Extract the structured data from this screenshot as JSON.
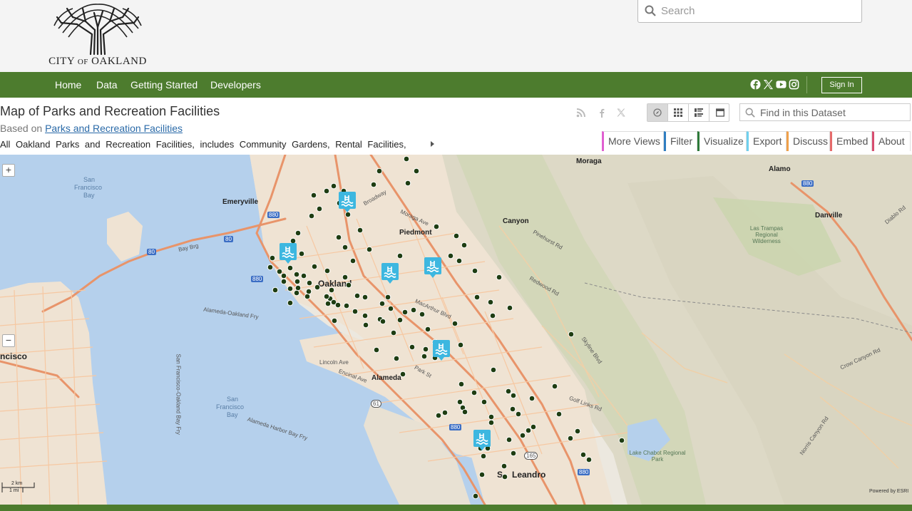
{
  "logo": {
    "text_city": "CITY",
    "text_of": "OF",
    "text_oakland": "OAKLAND"
  },
  "site_search": {
    "placeholder": "Search"
  },
  "nav": {
    "items": [
      "Home",
      "Data",
      "Getting Started",
      "Developers"
    ],
    "social_icons": [
      "facebook-icon",
      "x-twitter-icon",
      "youtube-icon",
      "instagram-icon"
    ],
    "sign_in": "Sign In"
  },
  "dataset": {
    "title": "Map of Parks and Recreation Facilities",
    "based_on_prefix": "Based on",
    "based_on_link": "Parks and Recreation Facilities",
    "description": "All Oakland Parks and Recreation Facilities, includes Community Gardens, Rental Facilities,",
    "search_placeholder": "Find in this Dataset",
    "share_icons": [
      "rss-icon",
      "facebook-icon",
      "x-twitter-icon"
    ],
    "view_buttons": [
      "map-view-icon",
      "grid-view-icon",
      "list-view-icon",
      "page-view-icon"
    ]
  },
  "tabs": [
    {
      "label": "More Views",
      "color": "#e05fd1"
    },
    {
      "label": "Filter",
      "color": "#2f7ec1"
    },
    {
      "label": "Visualize",
      "color": "#2e7a3a"
    },
    {
      "label": "Export",
      "color": "#6fd0ee"
    },
    {
      "label": "Discuss",
      "color": "#f0a04a"
    },
    {
      "label": "Embed",
      "color": "#e66b6b"
    },
    {
      "label": "About",
      "color": "#d74d6f"
    }
  ],
  "map": {
    "zoom_in": "+",
    "zoom_out": "−",
    "scale_km": "2 km",
    "scale_mi": "1 mi",
    "attribution": "Powered by ESRI",
    "labels": {
      "moraga": "Moraga",
      "alamo": "Alamo",
      "emeryville": "Emeryville",
      "piedmont": "Piedmont",
      "canyon": "Canyon",
      "danville": "Danville",
      "oakland": "Oakland",
      "alameda": "Alameda",
      "san_leandro_s": "S",
      "san_leandro": "Leandro",
      "francisco": "ncisco",
      "sf_bay_1": "San",
      "sf_bay_2": "Francisco",
      "sf_bay_3": "Bay",
      "sf_bay_b1": "San",
      "sf_bay_b2": "Francisco",
      "sf_bay_b3": "Bay",
      "las_trampas": "Las Trampas Regional Wilderness",
      "lake_chabot": "Lake Chabot Regional Park",
      "bay_bridge": "Bay Brg",
      "alameda_oakland_fry": "Alameda-Oakland Fry",
      "alameda_harbor_bay_fry": "Alameda Harbor Bay Fry",
      "lincoln_ave": "Lincoln Ave",
      "encinal_ave": "Encinal Ave",
      "park_st": "Park St",
      "broadway": "Broadway",
      "moraga_ave": "Moraga Ave",
      "macarthur": "MacArthur Blvd",
      "skyline_blvd": "Skyline Blvd",
      "crow_canyon": "Crow Canyon Rd",
      "norris_canyon": "Norris Canyon Rd",
      "camino_tassajara": "Diablo Rd",
      "redwood_rd": "Redwood Rd",
      "pinehurst": "Pinehurst Rd",
      "golf_links": "Golf Links Rd",
      "i880": "880",
      "i80": "80",
      "h61": "61",
      "h165": "165",
      "sf_sansome": "San Francisco-Oakland Bay Fry"
    }
  }
}
